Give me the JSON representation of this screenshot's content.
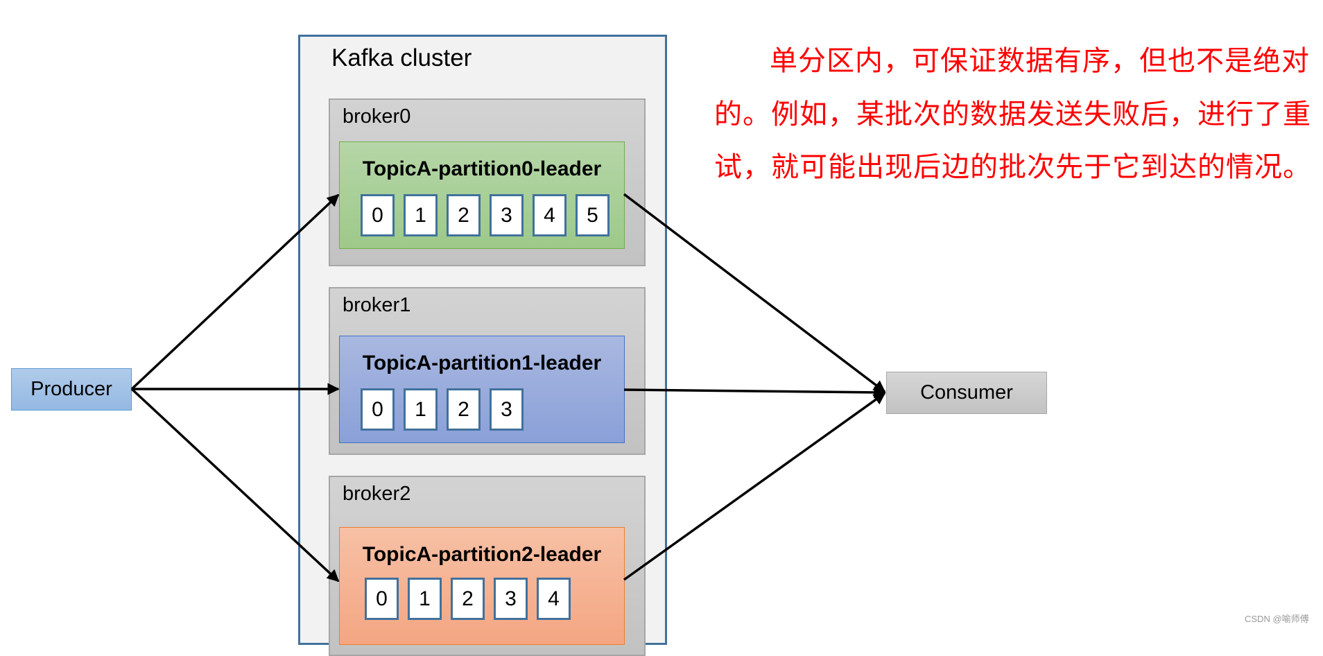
{
  "cluster": {
    "title": "Kafka cluster",
    "brokers": [
      {
        "label": "broker0",
        "partition": {
          "title": "TopicA-partition0-leader",
          "color": "green",
          "offsets": [
            "0",
            "1",
            "2",
            "3",
            "4",
            "5"
          ]
        }
      },
      {
        "label": "broker1",
        "partition": {
          "title": "TopicA-partition1-leader",
          "color": "blue",
          "offsets": [
            "0",
            "1",
            "2",
            "3"
          ]
        }
      },
      {
        "label": "broker2",
        "partition": {
          "title": "TopicA-partition2-leader",
          "color": "orange",
          "offsets": [
            "0",
            "1",
            "2",
            "3",
            "4"
          ]
        }
      }
    ]
  },
  "producer": {
    "label": "Producer"
  },
  "consumer": {
    "label": "Consumer"
  },
  "note": {
    "text": "单分区内，可保证数据有序，但也不是绝对的。例如，某批次的数据发送失败后，进行了重试，就可能出现后边的批次先于它到达的情况。",
    "color": "#ff0000"
  },
  "colors": {
    "cluster_border": "#41719c",
    "arrow": "#000000"
  },
  "watermark": "CSDN @喻师傅"
}
